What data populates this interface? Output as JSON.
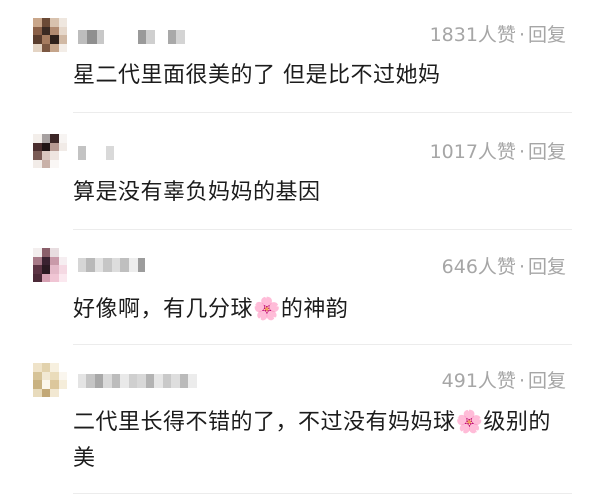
{
  "comments": [
    {
      "likes": "1831人赞",
      "dot": "·",
      "reply": "回复",
      "text": "星二代里面很美的了 但是比不过她妈"
    },
    {
      "likes": "1017人赞",
      "dot": "·",
      "reply": "回复",
      "text": "算是没有辜负妈妈的基因"
    },
    {
      "likes": "646人赞",
      "dot": "·",
      "reply": "回复",
      "text_a": "好像啊，有几分球",
      "text_b": "的神韵"
    },
    {
      "likes": "491人赞",
      "dot": "·",
      "reply": "回复",
      "text_a": "二代里长得不错的了，不过没有妈妈球",
      "text_b": "级别的美"
    }
  ],
  "icons": {
    "flower": "cherry-blossom-icon"
  },
  "colors": {
    "meta": "#a6a6a6",
    "text": "#1c1c1c",
    "divider": "#ececec",
    "flower": "#f08bb0"
  }
}
